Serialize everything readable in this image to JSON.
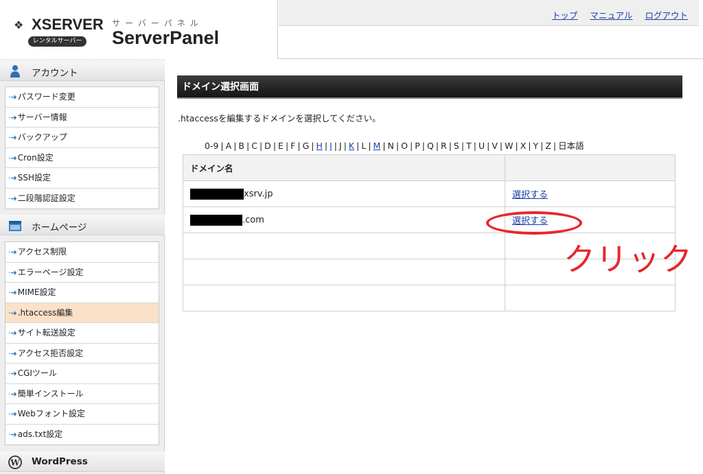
{
  "header": {
    "brand": "XSERVER",
    "brand_badge": "レンタルサーバー",
    "subtitle": "サーバーパネル",
    "title": "ServerPanel",
    "nav": [
      "トップ",
      "マニュアル",
      "ログアウト"
    ]
  },
  "sidebar": {
    "sections": [
      {
        "label": "アカウント",
        "icon": "user-icon"
      },
      {
        "label": "ホームページ",
        "icon": "homepage-icon"
      },
      {
        "label": "WordPress",
        "icon": "wordpress-icon"
      }
    ],
    "account_items": [
      "パスワード変更",
      "サーバー情報",
      "バックアップ",
      "Cron設定",
      "SSH設定",
      "二段階認証設定"
    ],
    "homepage_items": [
      "アクセス制限",
      "エラーページ設定",
      "MIME設定",
      ".htaccess編集",
      "サイト転送設定",
      "アクセス拒否設定",
      "CGIツール",
      "簡単インストール",
      "Webフォント設定",
      "ads.txt設定"
    ],
    "active_item": ".htaccess編集"
  },
  "main": {
    "title": "ドメイン選択画面",
    "instruction": ".htaccessを編集するドメインを選択してください。",
    "alpha_index": [
      "0-9",
      "A",
      "B",
      "C",
      "D",
      "E",
      "F",
      "G",
      "H",
      "I",
      "J",
      "K",
      "L",
      "M",
      "N",
      "O",
      "P",
      "Q",
      "R",
      "S",
      "T",
      "U",
      "V",
      "W",
      "X",
      "Y",
      "Z",
      "日本語"
    ],
    "alpha_links": [
      "H",
      "I",
      "K",
      "M"
    ],
    "table": {
      "header": "ドメイン名",
      "rows": [
        {
          "domain_suffix": "xsrv.jp",
          "action": "選択する"
        },
        {
          "domain_suffix": ".com",
          "action": "選択する"
        }
      ]
    },
    "annotation": "クリック"
  },
  "colors": {
    "link": "#1a3ea8",
    "active_item_bg": "#fbe1c7",
    "annotation": "#e8262a"
  }
}
